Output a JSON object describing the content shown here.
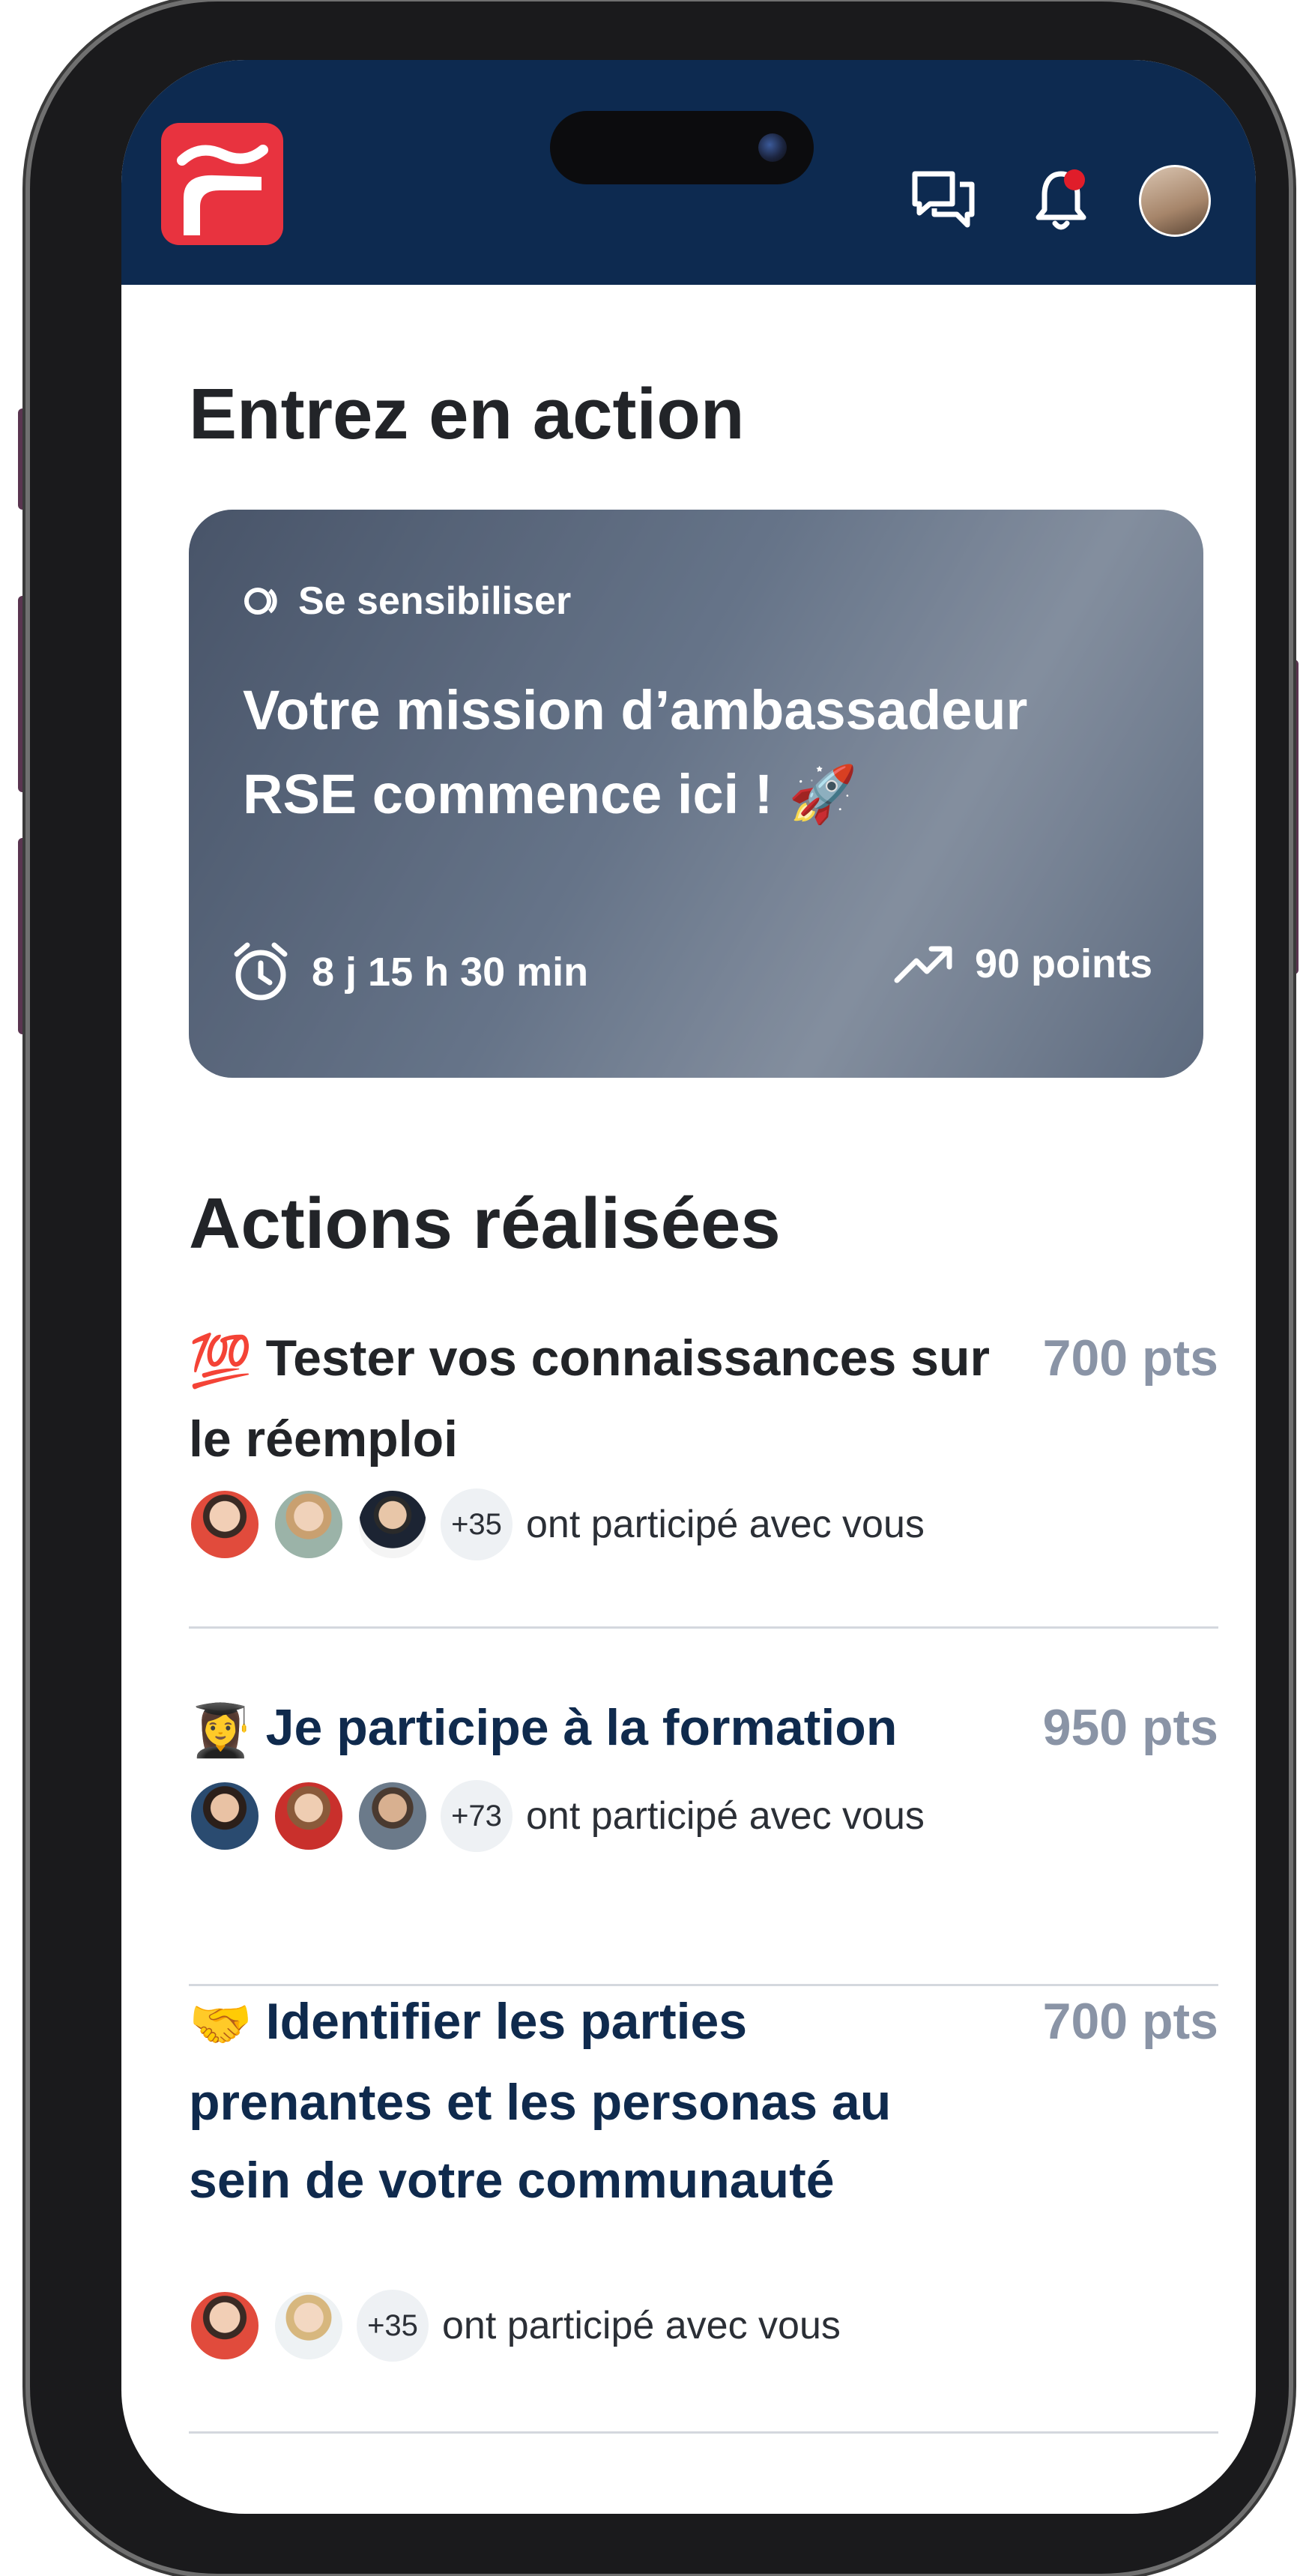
{
  "header": {
    "logo": "app-logo",
    "icons": [
      "chat-icon",
      "bell-icon",
      "user-avatar"
    ],
    "notification_dot": true
  },
  "sections": {
    "enter_action_title": "Entrez en action",
    "done_title": "Actions réalisées"
  },
  "featured": {
    "tag": "Se sensibiliser",
    "title": "Votre mission d’ambassadeur RSE commence ici !",
    "title_emoji": "🚀",
    "time_left": "8 j 15 h 30 min",
    "points": "90 points"
  },
  "actions": [
    {
      "emoji": "💯",
      "title": "Tester vos connaissances sur le réemploi",
      "points": "700 pts",
      "extra": "+35",
      "participated": "ont participé avec vous"
    },
    {
      "emoji": "👩‍🎓",
      "title": "Je participe à la formation",
      "points": "950 pts",
      "extra": "+73",
      "participated": "ont participé avec vous"
    },
    {
      "emoji": "🤝",
      "title": "Identifier les parties prenantes et les personas au sein de votre communauté",
      "points": "700 pts",
      "extra": "+35",
      "participated": "ont participé avec vous"
    }
  ],
  "colors": {
    "header_bg": "#0d2a50",
    "logo_red": "#e8333f",
    "title_navy": "#0f2a4d",
    "points_gray": "#8a94a6",
    "notification_red": "#e01d2a"
  }
}
